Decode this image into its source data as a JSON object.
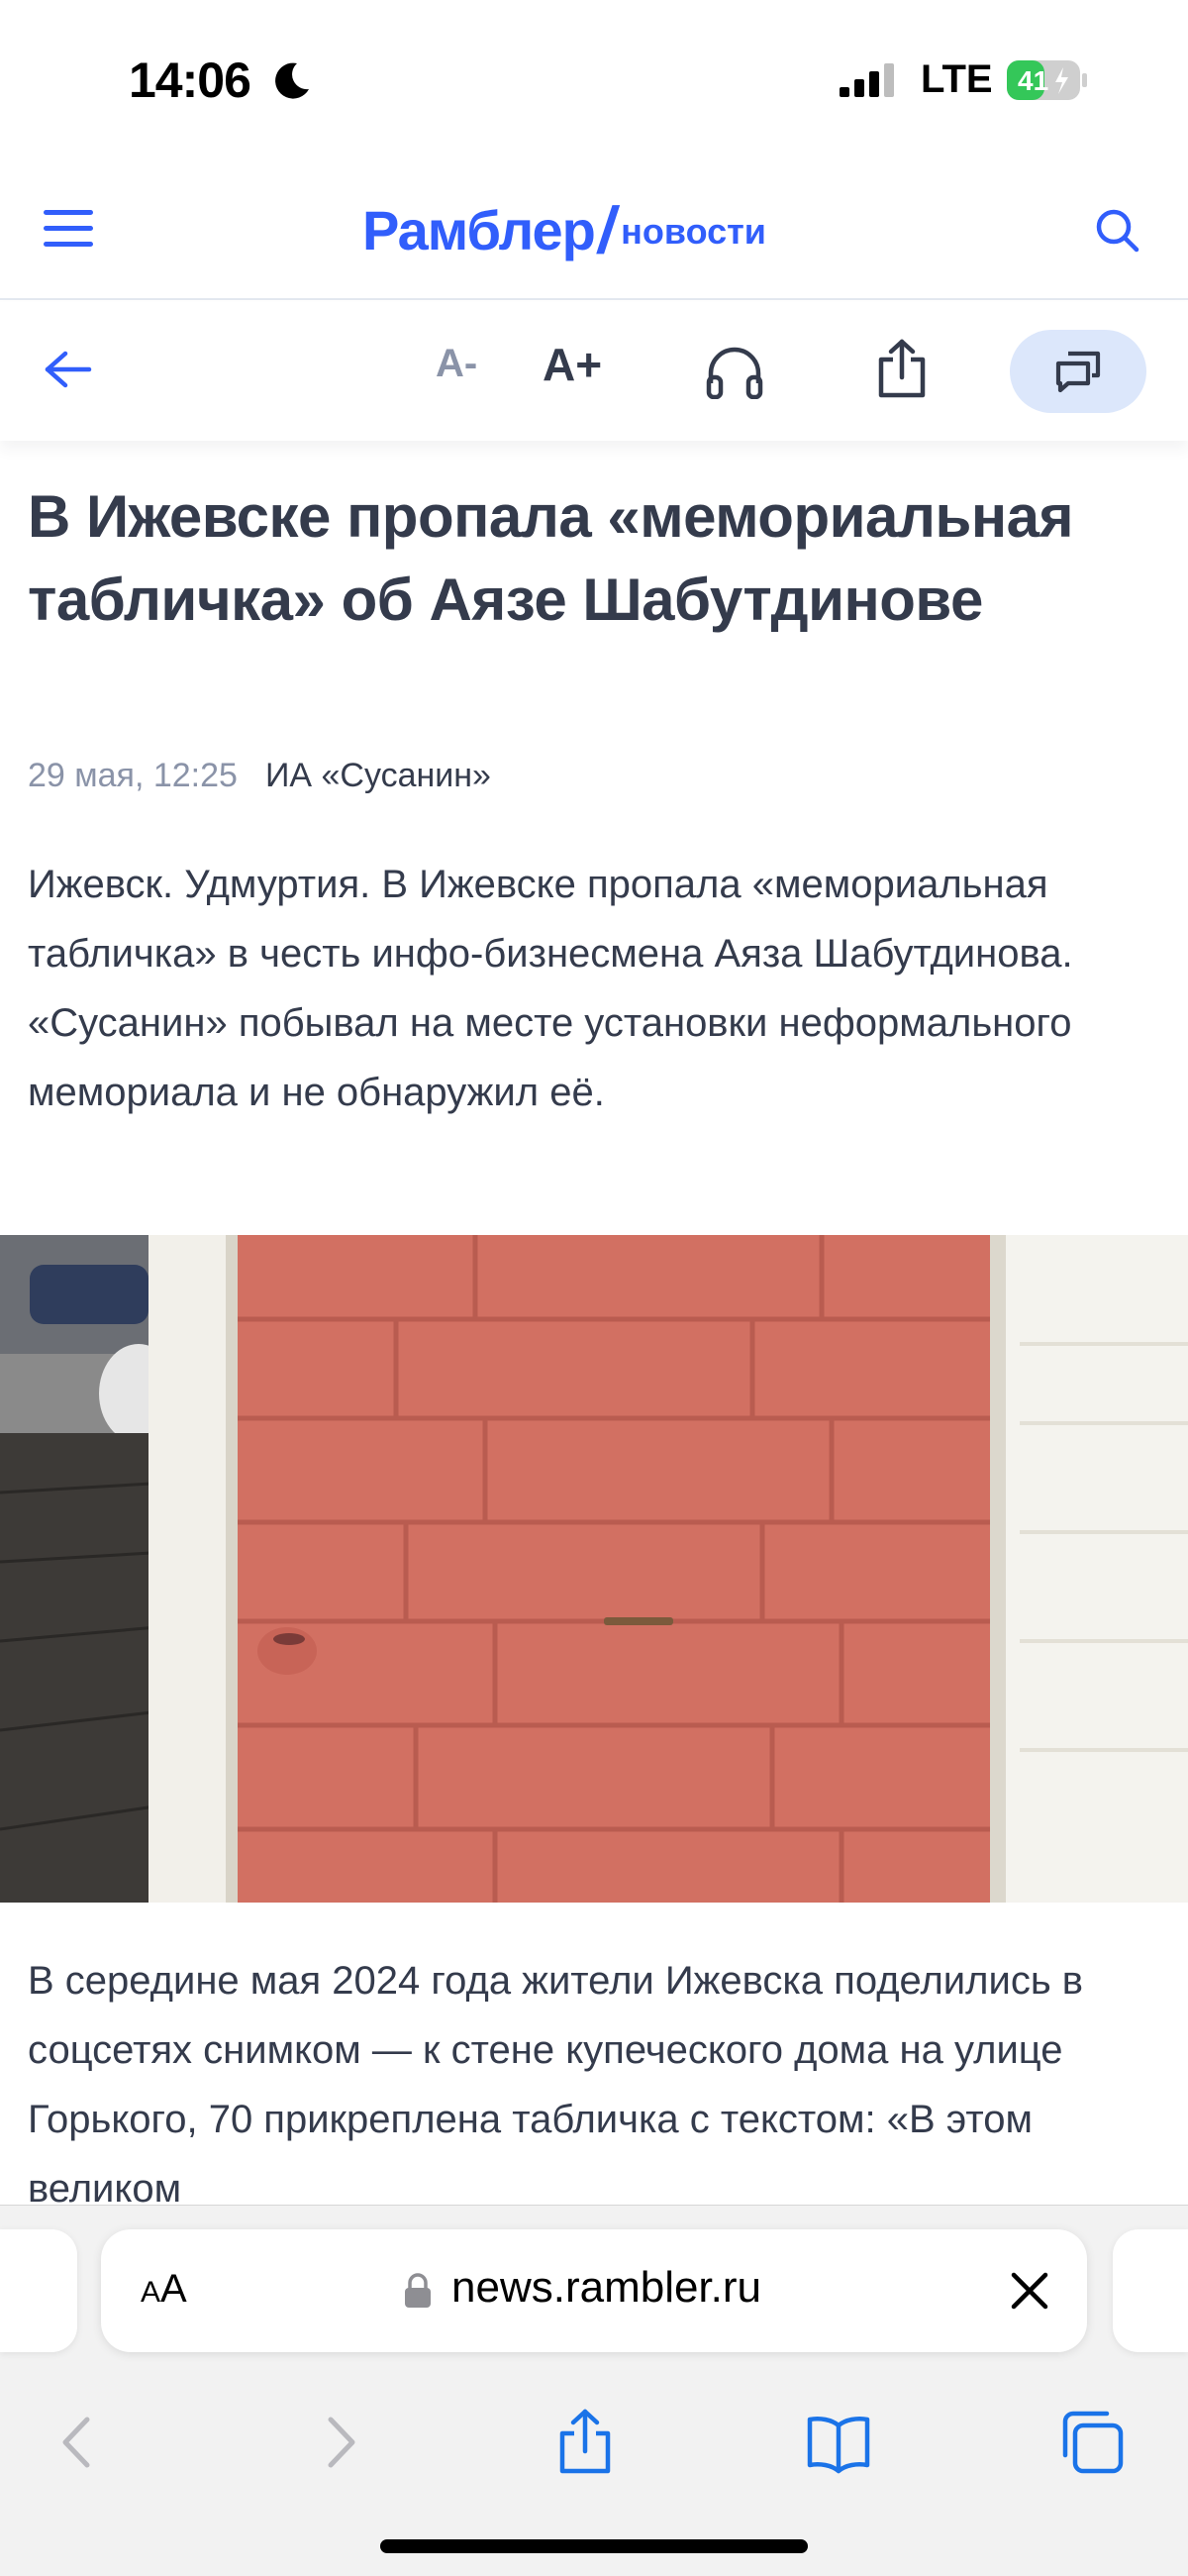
{
  "status_bar": {
    "time": "14:06",
    "network": "LTE",
    "battery": "41"
  },
  "header": {
    "logo_main": "Рамблер",
    "logo_slash": "/",
    "logo_sub": "новости"
  },
  "toolbar": {
    "font_decrease": "A-",
    "font_increase": "A+"
  },
  "article": {
    "title": "В Ижевске пропала «мемориальная табличка» об Аязе Шабутдинове",
    "date": "29 мая, 12:25",
    "source": "ИА «Сусанин»",
    "lead": "Ижевск. Удмуртия. В Ижевске пропала «мемориальная табличка» в честь инфо-бизнесмена Аяза Шабутдинова. «Сусанин» побывал на месте установки неформального мемориала и не обнаружил её.",
    "body": "В середине мая 2024 года жители Ижевска поделились в соцсетях снимком — к стене купеческого дома на улице Горького, 70 прикреплена табличка с текстом: «В этом великом"
  },
  "browser": {
    "aa_label_small": "A",
    "aa_label_large": "A",
    "url": "news.rambler.ru"
  },
  "colors": {
    "accent": "#315efb",
    "text": "#343b4c",
    "muted": "#8a93a8",
    "comments_bg": "#dce7fb",
    "brick": "#d27062"
  }
}
